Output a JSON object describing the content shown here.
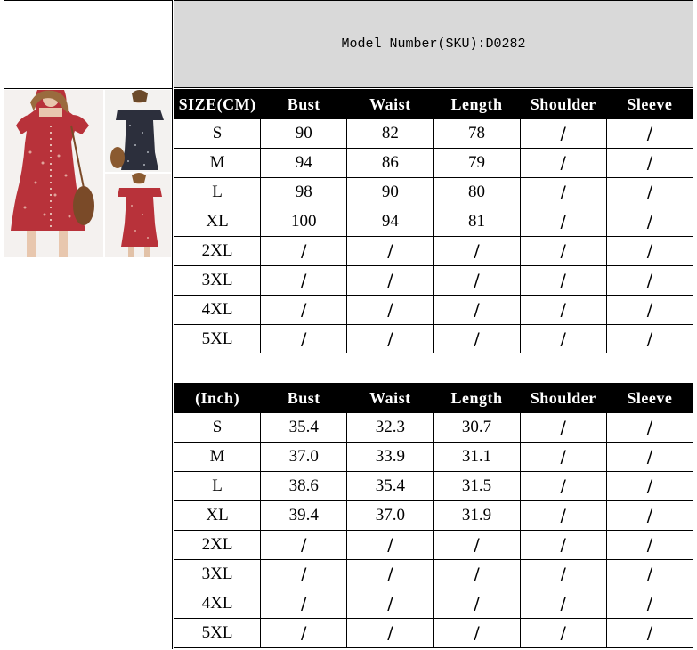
{
  "header": {
    "model_number": "Model Number(SKU):D0282"
  },
  "cm_table": {
    "headers": [
      "SIZE(CM)",
      "Bust",
      "Waist",
      "Length",
      "Shoulder",
      "Sleeve"
    ],
    "rows": [
      [
        "S",
        "90",
        "82",
        "78",
        "/",
        "/"
      ],
      [
        "M",
        "94",
        "86",
        "79",
        "/",
        "/"
      ],
      [
        "L",
        "98",
        "90",
        "80",
        "/",
        "/"
      ],
      [
        "XL",
        "100",
        "94",
        "81",
        "/",
        "/"
      ],
      [
        "2XL",
        "/",
        "/",
        "/",
        "/",
        "/"
      ],
      [
        "3XL",
        "/",
        "/",
        "/",
        "/",
        "/"
      ],
      [
        "4XL",
        "/",
        "/",
        "/",
        "/",
        "/"
      ],
      [
        "5XL",
        "/",
        "/",
        "/",
        "/",
        "/"
      ]
    ]
  },
  "inch_table": {
    "headers": [
      "(Inch)",
      "Bust",
      "Waist",
      "Length",
      "Shoulder",
      "Sleeve"
    ],
    "rows": [
      [
        "S",
        "35.4",
        "32.3",
        "30.7",
        "/",
        "/"
      ],
      [
        "M",
        "37.0",
        "33.9",
        "31.1",
        "/",
        "/"
      ],
      [
        "L",
        "38.6",
        "35.4",
        "31.5",
        "/",
        "/"
      ],
      [
        "XL",
        "39.4",
        "37.0",
        "31.9",
        "/",
        "/"
      ],
      [
        "2XL",
        "/",
        "/",
        "/",
        "/",
        "/"
      ],
      [
        "3XL",
        "/",
        "/",
        "/",
        "/",
        "/"
      ],
      [
        "4XL",
        "/",
        "/",
        "/",
        "/",
        "/"
      ],
      [
        "5XL",
        "/",
        "/",
        "/",
        "/",
        "/"
      ]
    ]
  },
  "colors": {
    "header_band": "#d9d9d9",
    "table_header": "#000000",
    "dress_red": "#b8323a",
    "dress_navy": "#2c2f3c"
  }
}
